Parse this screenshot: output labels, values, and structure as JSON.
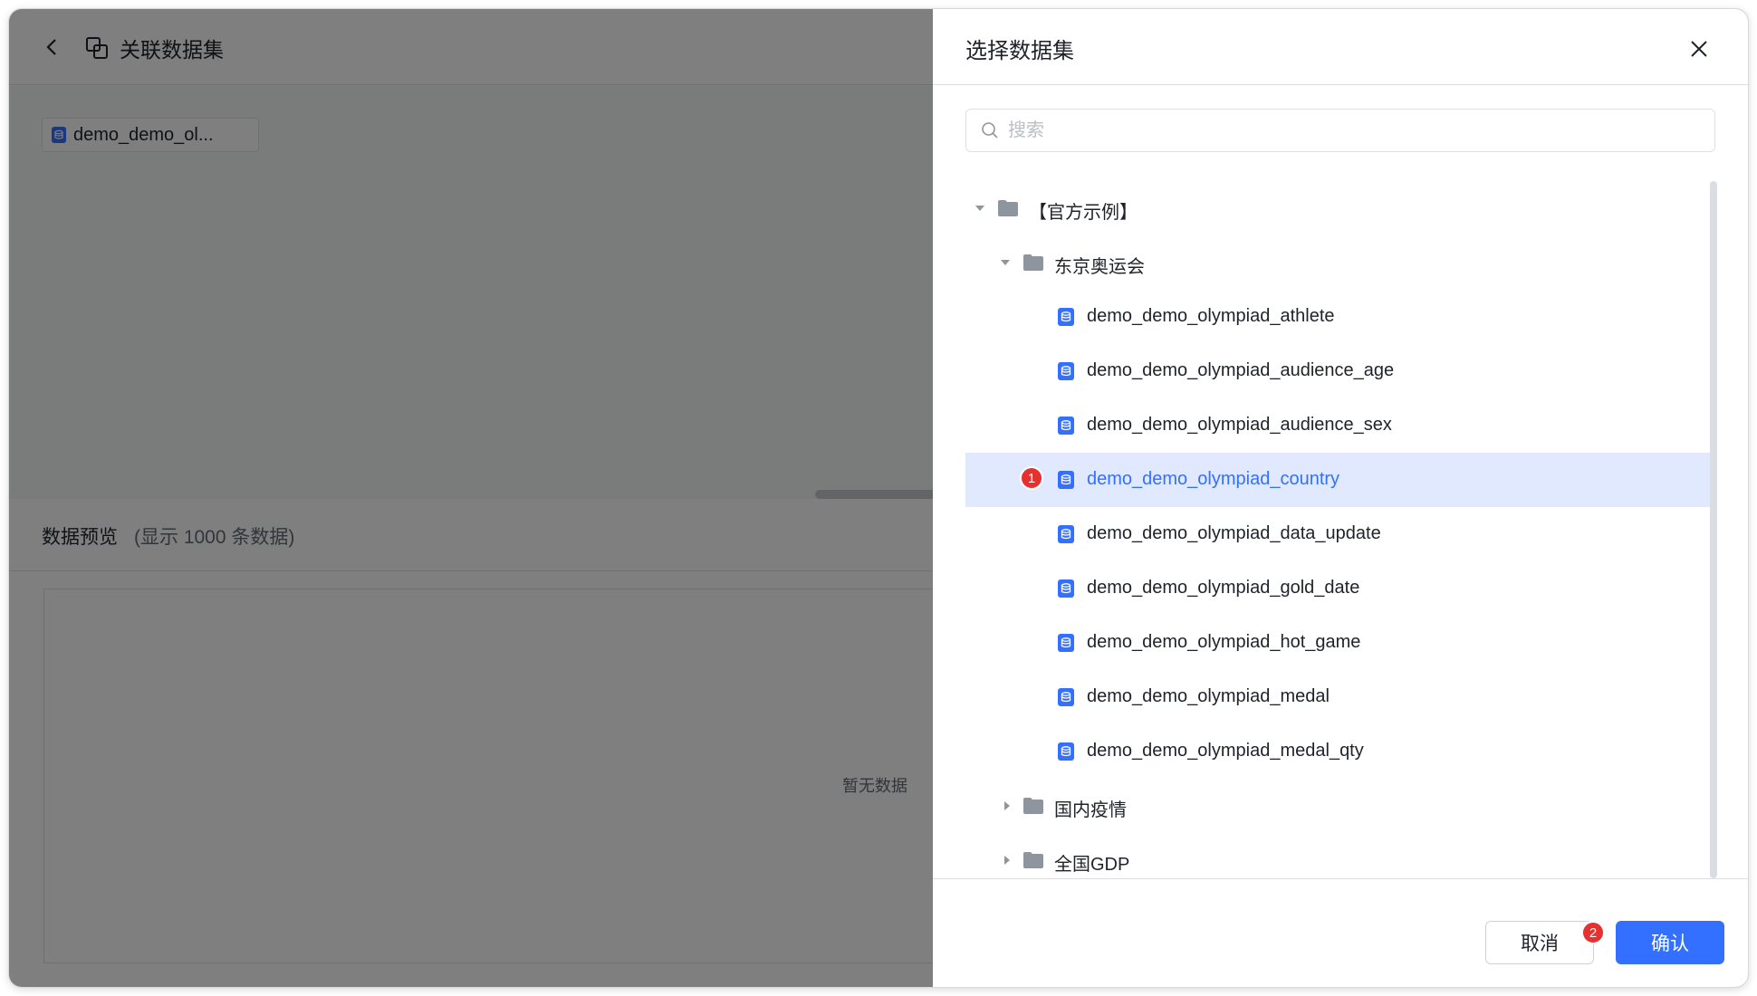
{
  "page": {
    "title": "关联数据集",
    "dataset_chip": "demo_demo_ol...",
    "preview_title": "数据预览",
    "preview_subtitle": "(显示 1000 条数据)",
    "empty_text": "暂无数据"
  },
  "drawer": {
    "title": "选择数据集",
    "search_placeholder": "搜索",
    "cancel_label": "取消",
    "confirm_label": "确认",
    "tree": {
      "root_folder": "【官方示例】",
      "subfolder": "东京奥运会",
      "datasets": [
        {
          "label": "demo_demo_olympiad_athlete"
        },
        {
          "label": "demo_demo_olympiad_audience_age"
        },
        {
          "label": "demo_demo_olympiad_audience_sex"
        },
        {
          "label": "demo_demo_olympiad_country",
          "selected": true
        },
        {
          "label": "demo_demo_olympiad_data_update"
        },
        {
          "label": "demo_demo_olympiad_gold_date"
        },
        {
          "label": "demo_demo_olympiad_hot_game"
        },
        {
          "label": "demo_demo_olympiad_medal"
        },
        {
          "label": "demo_demo_olympiad_medal_qty"
        }
      ],
      "collapsed_folders": [
        "国内疫情",
        "全国GDP"
      ]
    }
  },
  "markers": {
    "step1": "1",
    "step2": "2"
  },
  "colors": {
    "accent": "#3370ff",
    "selected_row": "#e0e9ff",
    "marker": "#e5312f",
    "overlay": "rgba(0,0,0,0.5)"
  }
}
